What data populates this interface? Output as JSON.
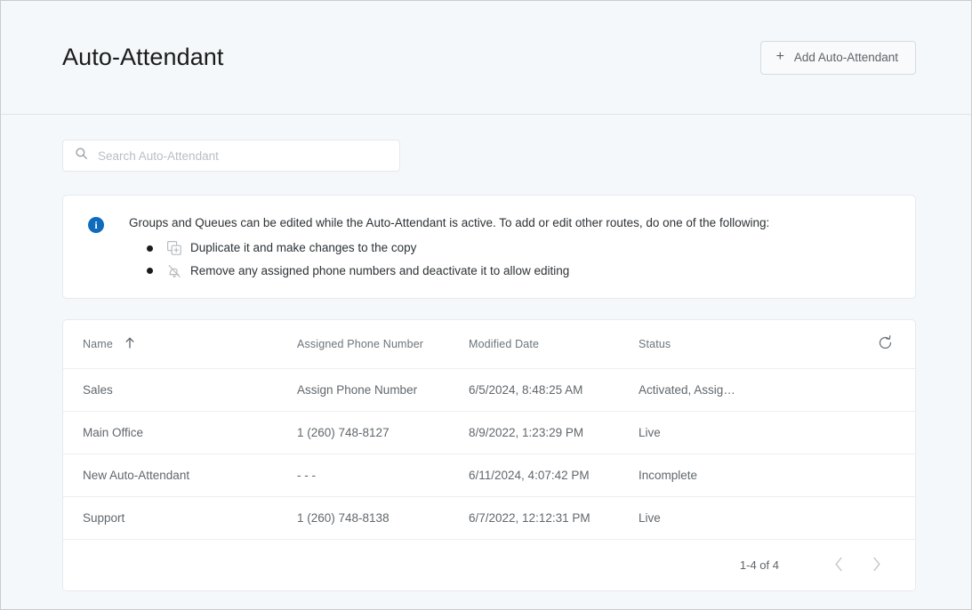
{
  "header": {
    "title": "Auto-Attendant",
    "add_button_label": "Add Auto-Attendant",
    "add_button_icon": "plus-icon",
    "plus_glyph": "+"
  },
  "search": {
    "icon": "search-icon",
    "placeholder": "Search Auto-Attendant",
    "value": ""
  },
  "info_banner": {
    "icon": "info-circle-icon",
    "icon_glyph": "i",
    "lead_text": "Groups and Queues can be edited while the Auto-Attendant is active. To add or edit other routes, do one of the following:",
    "items": [
      {
        "icon": "duplicate-icon",
        "text": "Duplicate it and make changes to the copy"
      },
      {
        "icon": "phone-off-icon",
        "text": "Remove any assigned phone numbers and deactivate it to allow editing"
      }
    ]
  },
  "table": {
    "columns": [
      {
        "label": "Name",
        "sort": "ascending",
        "sort_icon": "arrow-up-icon"
      },
      {
        "label": "Assigned Phone Number"
      },
      {
        "label": "Modified Date"
      },
      {
        "label": "Status"
      }
    ],
    "refresh_icon": "refresh-icon",
    "rows": [
      {
        "name": "Sales",
        "phone": "Assign Phone Number",
        "phone_is_link": true,
        "modified": "6/5/2024, 8:48:25 AM",
        "status": "Activated, Assign T…"
      },
      {
        "name": "Main Office",
        "phone": "1 (260) 748-8127",
        "phone_is_link": false,
        "modified": "8/9/2022, 1:23:29 PM",
        "status": "Live"
      },
      {
        "name": "New Auto-Attendant",
        "phone": "- - -",
        "phone_is_link": false,
        "modified": "6/11/2024, 4:07:42 PM",
        "status": "Incomplete"
      },
      {
        "name": "Support",
        "phone": "1 (260) 748-8138",
        "phone_is_link": false,
        "modified": "6/7/2022, 12:12:31 PM",
        "status": "Live"
      }
    ]
  },
  "pagination": {
    "range_label": "1-4 of 4",
    "prev_icon": "chevron-left-icon",
    "next_icon": "chevron-right-icon"
  },
  "colors": {
    "page_bg": "#f4f8fb",
    "link": "#1a86d9",
    "info_blue": "#0f6cbd",
    "text": "#2d3236",
    "muted": "#6d747a"
  }
}
